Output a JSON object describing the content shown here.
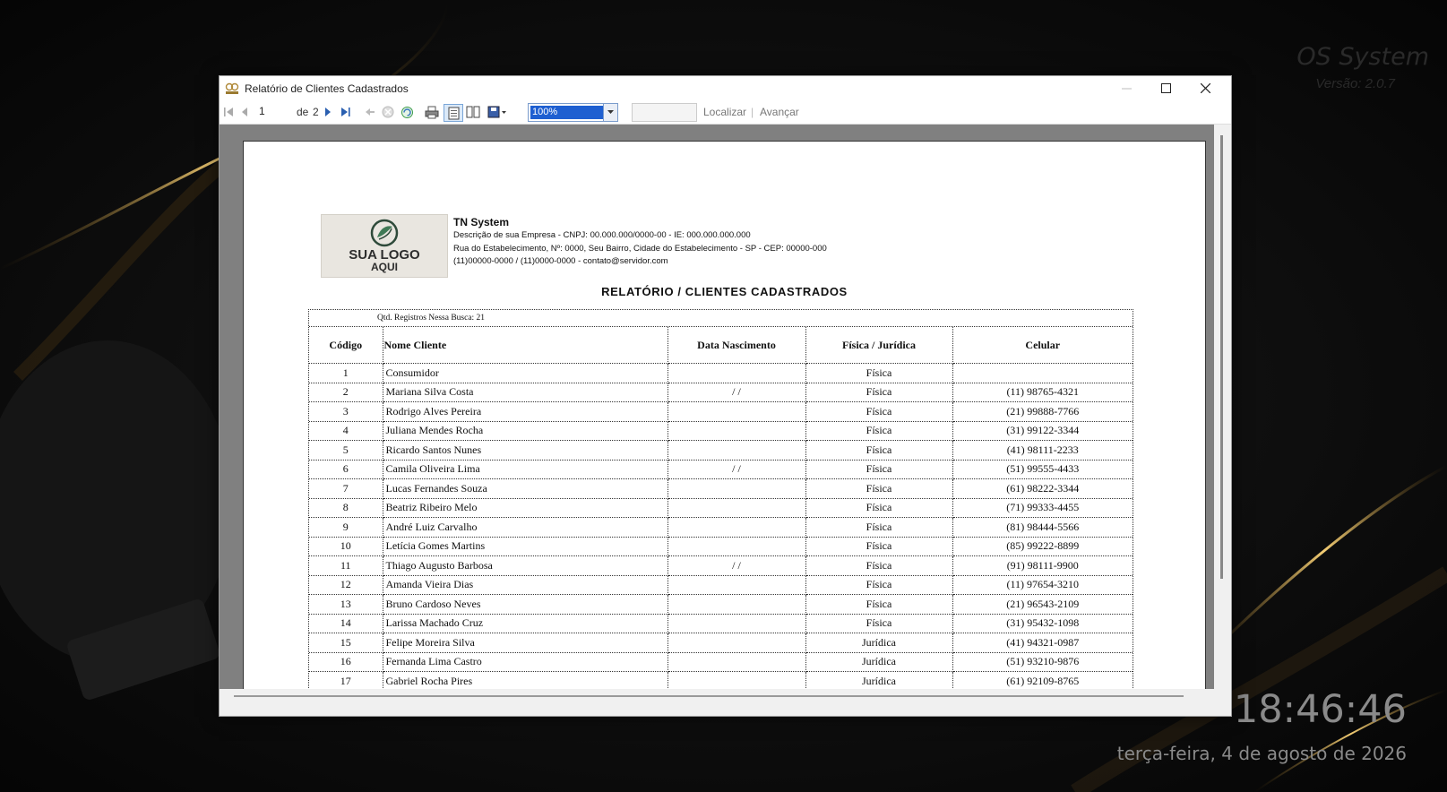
{
  "desktop": {
    "brand_name": "OS System",
    "brand_version": "Versão: 2.0.7",
    "clock": "18:46:46",
    "date": "terça-feira, 4 de agosto de 2026"
  },
  "window": {
    "title": "Relatório de Clientes Cadastrados",
    "controls": [
      "minimize",
      "maximize",
      "close"
    ]
  },
  "toolbar": {
    "current_page": "1",
    "page_of": "de",
    "total_pages": "2",
    "zoom": "100%",
    "find_label": "Localizar",
    "next_label": "Avançar"
  },
  "report": {
    "logo_line1": "SUA LOGO",
    "logo_line2": "AQUI",
    "company_name": "TN System",
    "company_desc": "Descrição de sua Empresa  - CNPJ: 00.000.000/0000-00 -  IE: 000.000.000.000",
    "company_address": "Rua do Estabelecimento,  Nº: 0000,  Seu Bairro,  Cidade do Estabelecimento -  SP -  CEP: 00000-000",
    "company_contact": "(11)00000-0000 /  (11)0000-0000 -  contato@servidor.com",
    "title": "RELATÓRIO / CLIENTES CADASTRADOS",
    "records_count": "Qtd. Registros Nessa Busca: 21",
    "columns": [
      "Código",
      "Nome Cliente",
      "Data Nascimento",
      "Física / Jurídica",
      "Celular"
    ],
    "rows": [
      {
        "code": "1",
        "name": "Consumidor",
        "birth": "",
        "type": "Física",
        "phone": ""
      },
      {
        "code": "2",
        "name": "Mariana Silva Costa",
        "birth": "/ /",
        "type": "Física",
        "phone": "(11) 98765-4321"
      },
      {
        "code": "3",
        "name": "Rodrigo Alves Pereira",
        "birth": "",
        "type": "Física",
        "phone": "(21) 99888-7766"
      },
      {
        "code": "4",
        "name": "Juliana Mendes Rocha",
        "birth": "",
        "type": "Física",
        "phone": "(31) 99122-3344"
      },
      {
        "code": "5",
        "name": "Ricardo Santos Nunes",
        "birth": "",
        "type": "Física",
        "phone": "(41) 98111-2233"
      },
      {
        "code": "6",
        "name": "Camila Oliveira Lima",
        "birth": "/ /",
        "type": "Física",
        "phone": "(51) 99555-4433"
      },
      {
        "code": "7",
        "name": "Lucas Fernandes Souza",
        "birth": "",
        "type": "Física",
        "phone": "(61) 98222-3344"
      },
      {
        "code": "8",
        "name": "Beatriz Ribeiro Melo",
        "birth": "",
        "type": "Física",
        "phone": "(71) 99333-4455"
      },
      {
        "code": "9",
        "name": "André Luiz Carvalho",
        "birth": "",
        "type": "Física",
        "phone": "(81) 98444-5566"
      },
      {
        "code": "10",
        "name": "Letícia Gomes Martins",
        "birth": "",
        "type": "Física",
        "phone": "(85) 99222-8899"
      },
      {
        "code": "11",
        "name": "Thiago Augusto Barbosa",
        "birth": "/ /",
        "type": "Física",
        "phone": "(91) 98111-9900"
      },
      {
        "code": "12",
        "name": "Amanda Vieira Dias",
        "birth": "",
        "type": "Física",
        "phone": "(11) 97654-3210"
      },
      {
        "code": "13",
        "name": "Bruno Cardoso Neves",
        "birth": "",
        "type": "Física",
        "phone": "(21) 96543-2109"
      },
      {
        "code": "14",
        "name": "Larissa Machado Cruz",
        "birth": "",
        "type": "Física",
        "phone": "(31) 95432-1098"
      },
      {
        "code": "15",
        "name": "Felipe Moreira Silva",
        "birth": "",
        "type": "Jurídica",
        "phone": "(41) 94321-0987"
      },
      {
        "code": "16",
        "name": "Fernanda Lima Castro",
        "birth": "",
        "type": "Jurídica",
        "phone": "(51) 93210-9876"
      },
      {
        "code": "17",
        "name": "Gabriel Rocha Pires",
        "birth": "",
        "type": "Jurídica",
        "phone": "(61) 92109-8765"
      }
    ]
  },
  "colors": {
    "accent_gold": "#d4a64a",
    "zoom_highlight": "#1e5fd1"
  }
}
